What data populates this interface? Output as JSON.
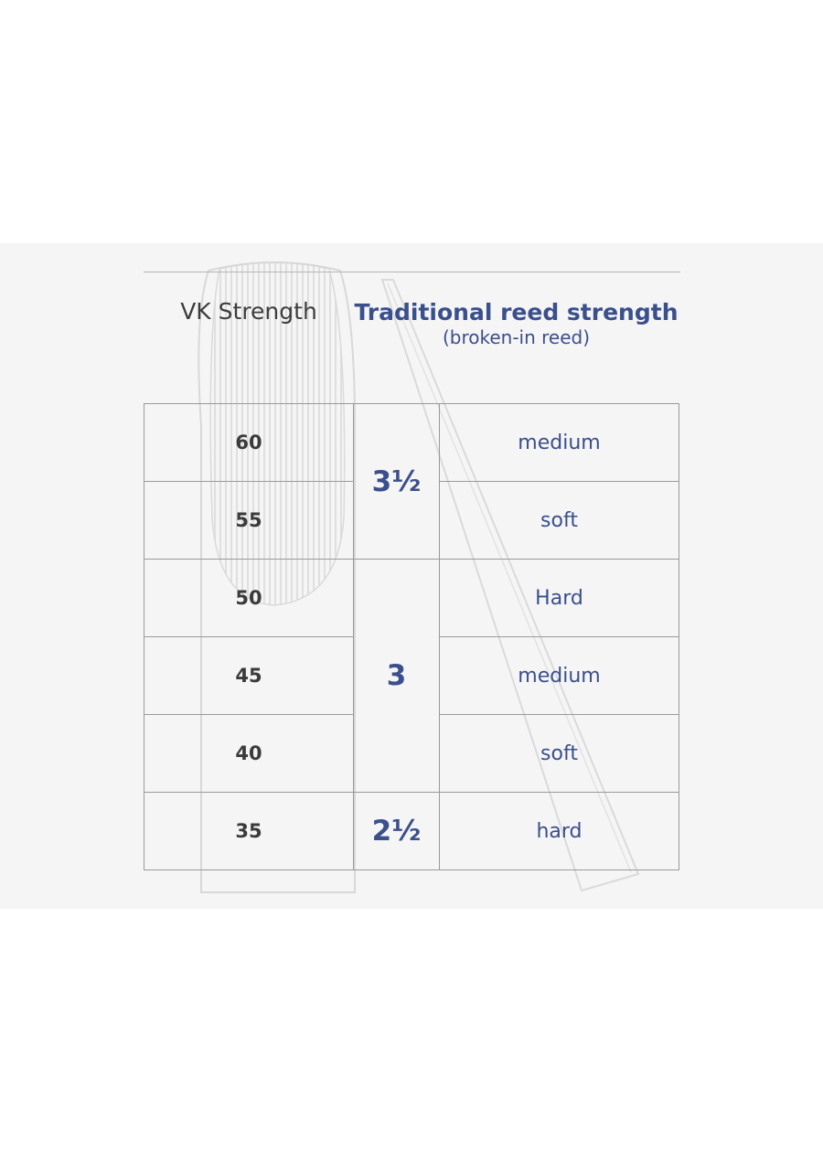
{
  "headers": {
    "vk": "VK Strength",
    "traditional": "Traditional reed strength",
    "traditional_note": "(broken-in reed)"
  },
  "rows": [
    {
      "vk": "60",
      "feel": "medium"
    },
    {
      "vk": "55",
      "feel": "soft"
    },
    {
      "vk": "50",
      "feel": "Hard"
    },
    {
      "vk": "45",
      "feel": "medium"
    },
    {
      "vk": "40",
      "feel": "soft"
    },
    {
      "vk": "35",
      "feel": "hard"
    }
  ],
  "groups": [
    {
      "strength": "3½"
    },
    {
      "strength": "3"
    },
    {
      "strength": "2½"
    }
  ],
  "colors": {
    "accent": "#3a4f8c",
    "text": "#3b3b3b",
    "grid": "#9a9a9a",
    "panel": "#f5f5f5"
  }
}
